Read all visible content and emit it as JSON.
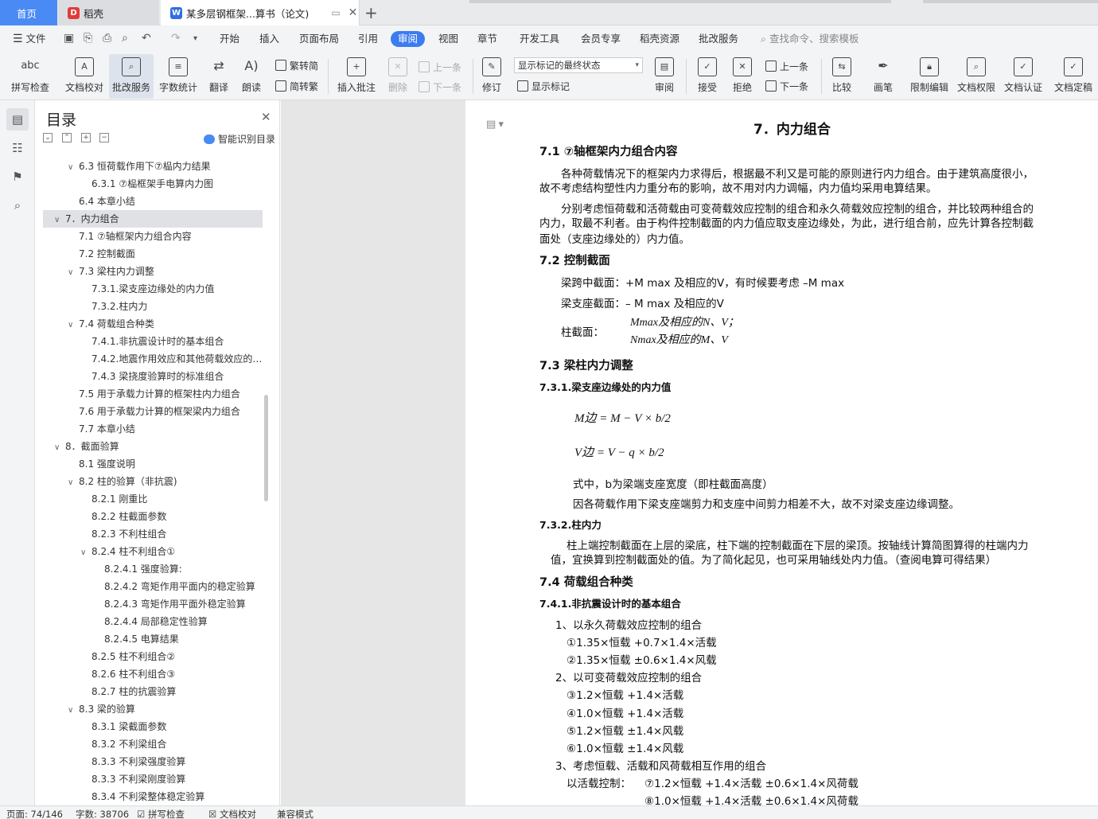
{
  "tabs": {
    "home": "首页",
    "wps": "稻壳",
    "doc": "某多层钢框架...算书（论文)"
  },
  "menu": [
    "文件",
    "开始",
    "插入",
    "页面布局",
    "引用",
    "审阅",
    "视图",
    "章节",
    "开发工具",
    "会员专享",
    "稻壳资源",
    "批改服务"
  ],
  "menu_active": "审阅",
  "search_placeholder": "查找命令、搜索模板",
  "ribbon": {
    "spell": "拼写检查",
    "proof": "文档校对",
    "correct": "批改服务",
    "count": "字数统计",
    "translate": "翻译",
    "read": "朗读",
    "trad": "繁转简",
    "simp": "简转繁",
    "insert_comment": "插入批注",
    "delete": "删除",
    "prev_comment": "上一条",
    "next_comment": "下一条",
    "revise": "修订",
    "markup_select": "显示标记的最终状态",
    "show_markup": "显示标记",
    "review": "审阅",
    "accept": "接受",
    "reject": "拒绝",
    "prev": "上一条",
    "next": "下一条",
    "compare": "比较",
    "pen": "画笔",
    "restrict": "限制编辑",
    "rights": "文档权限",
    "auth": "文档认证",
    "finalize": "文档定稿"
  },
  "toc": {
    "title": "目录",
    "smart": "智能识别目录",
    "items": [
      {
        "t": "6.3 恒荷载作用下⑦榀内力结果",
        "lv": 2,
        "ar": "v"
      },
      {
        "t": "6.3.1 ⑦榀框架手电算内力图",
        "lv": 3,
        "ar": ""
      },
      {
        "t": "6.4 本章小结",
        "lv": 2,
        "ar": ""
      },
      {
        "t": "7．内力组合",
        "lv": 1,
        "ar": "v",
        "sel": true
      },
      {
        "t": "7.1 ⑦轴框架内力组合内容",
        "lv": 2,
        "ar": ""
      },
      {
        "t": "7.2 控制截面",
        "lv": 2,
        "ar": ""
      },
      {
        "t": "7.3 梁柱内力调整",
        "lv": 2,
        "ar": "v"
      },
      {
        "t": "7.3.1.梁支座边缘处的内力值",
        "lv": 3,
        "ar": ""
      },
      {
        "t": "7.3.2.柱内力",
        "lv": 3,
        "ar": ""
      },
      {
        "t": "7.4 荷载组合种类",
        "lv": 2,
        "ar": "v"
      },
      {
        "t": "7.4.1.非抗震设计时的基本组合",
        "lv": 3,
        "ar": ""
      },
      {
        "t": "7.4.2.地震作用效应和其他荷载效应的 ...",
        "lv": 3,
        "ar": ""
      },
      {
        "t": "7.4.3 梁挠度验算时的标准组合",
        "lv": 3,
        "ar": ""
      },
      {
        "t": "7.5 用于承载力计算的框架柱内力组合",
        "lv": 2,
        "ar": ""
      },
      {
        "t": "7.6 用于承载力计算的框架梁内力组合",
        "lv": 2,
        "ar": ""
      },
      {
        "t": "7.7 本章小结",
        "lv": 2,
        "ar": ""
      },
      {
        "t": "8．截面验算",
        "lv": 1,
        "ar": "v"
      },
      {
        "t": "8.1 强度说明",
        "lv": 2,
        "ar": ""
      },
      {
        "t": "8.2 柱的验算（非抗震)",
        "lv": 2,
        "ar": "v"
      },
      {
        "t": "8.2.1 刚重比",
        "lv": 3,
        "ar": ""
      },
      {
        "t": "8.2.2 柱截面参数",
        "lv": 3,
        "ar": ""
      },
      {
        "t": "8.2.3 不利柱组合",
        "lv": 3,
        "ar": ""
      },
      {
        "t": "8.2.4 柱不利组合①",
        "lv": 3,
        "ar": "v"
      },
      {
        "t": "8.2.4.1 强度验算:",
        "lv": 4,
        "ar": ""
      },
      {
        "t": "8.2.4.2 弯矩作用平面内的稳定验算",
        "lv": 4,
        "ar": ""
      },
      {
        "t": "8.2.4.3 弯矩作用平面外稳定验算",
        "lv": 4,
        "ar": ""
      },
      {
        "t": "8.2.4.4 局部稳定性验算",
        "lv": 4,
        "ar": ""
      },
      {
        "t": "8.2.4.5 电算结果",
        "lv": 4,
        "ar": ""
      },
      {
        "t": "8.2.5 柱不利组合②",
        "lv": 3,
        "ar": ""
      },
      {
        "t": "8.2.6 柱不利组合③",
        "lv": 3,
        "ar": ""
      },
      {
        "t": "8.2.7 柱的抗震验算",
        "lv": 3,
        "ar": ""
      },
      {
        "t": "8.3 梁的验算",
        "lv": 2,
        "ar": "v"
      },
      {
        "t": "8.3.1 梁截面参数",
        "lv": 3,
        "ar": ""
      },
      {
        "t": "8.3.2 不利梁组合",
        "lv": 3,
        "ar": ""
      },
      {
        "t": "8.3.3 不利梁强度验算",
        "lv": 3,
        "ar": ""
      },
      {
        "t": "8.3.3 不利梁刚度验算",
        "lv": 3,
        "ar": ""
      },
      {
        "t": "8.3.4 不利梁整体稳定验算",
        "lv": 3,
        "ar": ""
      }
    ]
  },
  "doc": {
    "h1": "7．内力组合",
    "s71": "7.1 ⑦轴框架内力组合内容",
    "p1a": "各种荷载情况下的框架内力求得后，根据最不利又是可能的原则进行内力组合。由于建筑高度很小，",
    "p1b": "故不考虑结构塑性内力重分布的影响，故不用对内力调幅，内力值均采用电算结果。",
    "p2a": "分别考虑恒荷载和活荷载由可变荷载效应控制的组合和永久荷载效应控制的组合，并比较两种组合的",
    "p2b": "内力，取最不利者。由于构件控制截面的内力值应取支座边缘处，为此，进行组合前，应先计算各控制截",
    "p2c": "面处（支座边缘处的）内力值。",
    "s72": "7.2 控制截面",
    "c1": "梁跨中截面：+M max 及相应的V，有时候要考虑 –M max",
    "c2": "梁支座截面：– M max 及相应的V",
    "c3": "柱截面：",
    "c3a": "Mmax及相应的N、V；",
    "c3b": "Nmax及相应的M、V",
    "s73": "7.3 梁柱内力调整",
    "s731": "7.3.1.梁支座边缘处的内力值",
    "f1": "M边 = M − V × b/2",
    "f2": "V边 = V − q × b/2",
    "n1": "式中，b为梁端支座宽度（即柱截面高度）",
    "n2": "因各荷载作用下梁支座端剪力和支座中间剪力相差不大，故不对梁支座边缘调整。",
    "s732": "7.3.2.柱内力",
    "p3a": "柱上端控制截面在上层的梁底，柱下端的控制截面在下层的梁顶。按轴线计算简图算得的柱端内力",
    "p3b": "值，宜换算到控制截面处的值。为了简化起见，也可采用轴线处内力值。（查阅电算可得结果）",
    "s74": "7.4 荷载组合种类",
    "s741": "7.4.1.非抗震设计时的基本组合",
    "l1": "1、以永久荷载效应控制的组合",
    "l1a": "①1.35×恒载 +0.7×1.4×活载",
    "l1b": "②1.35×恒载 ±0.6×1.4×风载",
    "l2": "2、以可变荷载效应控制的组合",
    "l2a": "③1.2×恒载 +1.4×活载",
    "l2b": "④1.0×恒载 +1.4×活载",
    "l2c": "⑤1.2×恒载 ±1.4×风载",
    "l2d": "⑥1.0×恒载 ±1.4×风载",
    "l3": "3、考虑恒载、活载和风荷载相互作用的组合",
    "l3h": "以活载控制：",
    "l3a": "⑦1.2×恒载 +1.4×活载 ±0.6×1.4×风荷载",
    "l3b": "⑧1.0×恒载 +1.4×活载 ±0.6×1.4×风荷载"
  },
  "status": {
    "page": "页面: 74/146",
    "words": "字数: 38706",
    "spell": "拼写检查",
    "proof": "文档校对",
    "compat": "兼容模式"
  }
}
